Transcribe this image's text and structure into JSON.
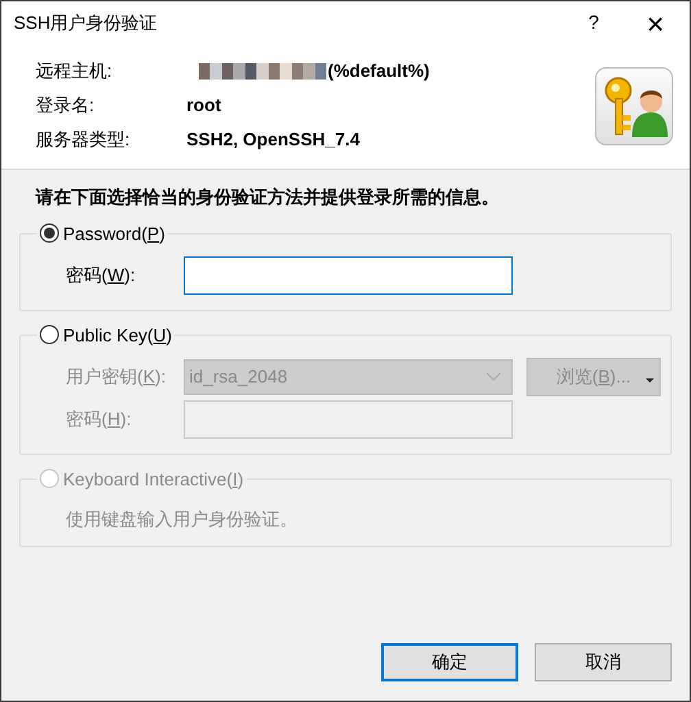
{
  "window": {
    "title": "SSH用户身份验证",
    "help": "?",
    "close": "×"
  },
  "info": [
    {
      "label": "远程主机:",
      "value": "(%default%)",
      "redacted": true
    },
    {
      "label": "登录名:",
      "value": "root",
      "redacted": false
    },
    {
      "label": "服务器类型:",
      "value": "SSH2, OpenSSH_7.4",
      "redacted": false
    }
  ],
  "instruction": "请在下面选择恰当的身份验证方法并提供登录所需的信息。",
  "methods": [
    {
      "label_parts": [
        "Password(",
        "P",
        ")"
      ],
      "selected": true,
      "disabled": false,
      "fields": [
        {
          "kind": "input",
          "label_parts": [
            "密码(",
            "W",
            "):"
          ],
          "focused": true
        }
      ]
    },
    {
      "label_parts": [
        "Public Key(",
        "U",
        ")"
      ],
      "selected": false,
      "disabled": false,
      "fields": [
        {
          "kind": "select",
          "label_parts": [
            "用户密钥(",
            "K",
            "):"
          ],
          "value": "id_rsa_2048",
          "button_parts": [
            "浏览(",
            "B",
            ")..."
          ]
        },
        {
          "kind": "input",
          "label_parts": [
            "密码(",
            "H",
            "):"
          ],
          "focused": false
        }
      ]
    },
    {
      "label_parts": [
        "Keyboard Interactive(",
        "I",
        ")"
      ],
      "selected": false,
      "disabled": true,
      "description": "使用键盘输入用户身份验证。"
    }
  ],
  "buttons": [
    {
      "label": "确定",
      "default": true
    },
    {
      "label": "取消",
      "default": false
    }
  ]
}
